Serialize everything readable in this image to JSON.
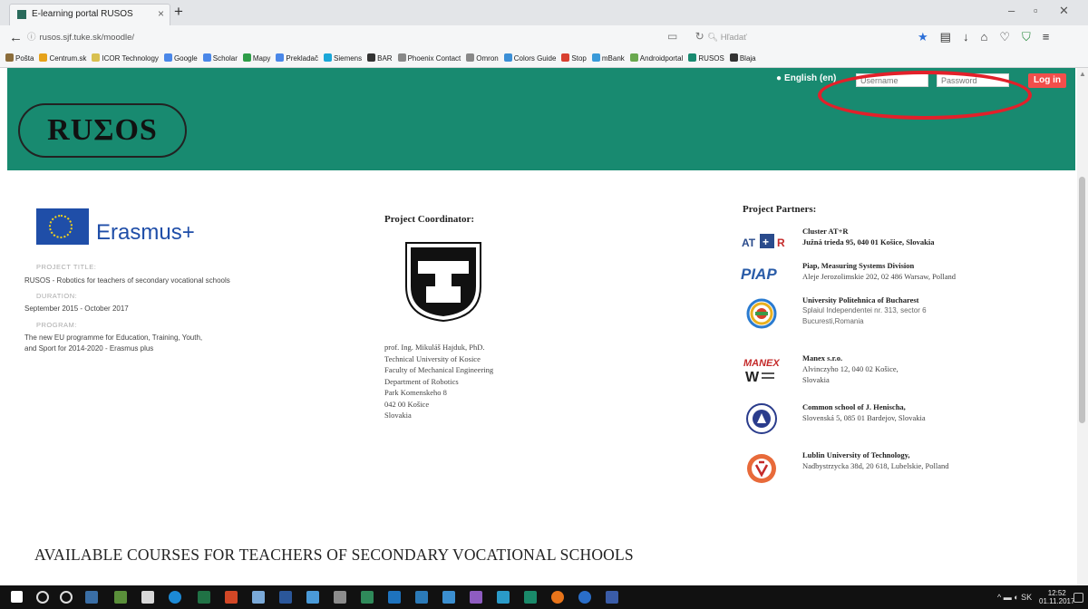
{
  "browser": {
    "tab_title": "E-learning portal RUSOS",
    "url": "rusos.sjf.tuke.sk/moodle/",
    "search_placeholder": "Hľadať",
    "bookmarks": [
      {
        "label": "Pošta",
        "color": "#8b6d3b"
      },
      {
        "label": "Centrum.sk",
        "color": "#e6a21a"
      },
      {
        "label": "ICOR Technology",
        "color": "#d8c050"
      },
      {
        "label": "Google",
        "color": "#4a87e8"
      },
      {
        "label": "Scholar",
        "color": "#4a87e8"
      },
      {
        "label": "Mapy",
        "color": "#2e9d48"
      },
      {
        "label": "Prekladač",
        "color": "#4a87e8"
      },
      {
        "label": "Siemens",
        "color": "#1aa7d8"
      },
      {
        "label": "BAR",
        "color": "#333333"
      },
      {
        "label": "Phoenix Contact",
        "color": "#888888"
      },
      {
        "label": "Omron",
        "color": "#888888"
      },
      {
        "label": "Colors Guide",
        "color": "#3c8fd6"
      },
      {
        "label": "Stop",
        "color": "#d84030"
      },
      {
        "label": "mBank",
        "color": "#3a9ad9"
      },
      {
        "label": "Androidportal",
        "color": "#6aa84f"
      },
      {
        "label": "RUSOS",
        "color": "#188a70"
      },
      {
        "label": "Blaja",
        "color": "#333333"
      }
    ]
  },
  "header": {
    "language": "English (en)",
    "username_placeholder": "Username",
    "password_placeholder": "Password",
    "login_label": "Log in",
    "logo_text": "RUΣOS"
  },
  "project": {
    "erasmus_label": "Erasmus+",
    "title_label": "PROJECT TITLE:",
    "title_value": "RUSOS - Robotics for teachers of secondary vocational schools",
    "duration_label": "DURATION:",
    "duration_value": "September 2015 - October 2017",
    "program_label": "PROGRAM:",
    "program_value_1": "The new EU programme for Education, Training, Youth,",
    "program_value_2": "and Sport for 2014-2020 - Erasmus plus"
  },
  "coordinator": {
    "heading": "Project Coordinator:",
    "lines": [
      "prof. Ing. Mikuláš Hajduk, PhD.",
      "Technical University of Kosice",
      "Faculty of Mechanical Engineering",
      "Department of Robotics",
      "Park Komenskeho 8",
      "042 00 Košice",
      "Slovakia"
    ]
  },
  "partners": {
    "heading": "Project Partners:",
    "items": [
      {
        "name": "Cluster AT+R",
        "line2": "Južná trieda 95, 040 01 Košice, Slovakia"
      },
      {
        "name": "Piap, Measuring Systems Division",
        "line2": "Aleje Jerozolimskie 202, 02 486 Warsaw, Polland"
      },
      {
        "name": "University Politehnica of Bucharest",
        "line2": "Splaiul Independentei nr. 313, sector 6",
        "line3": "Bucuresti,Romania"
      },
      {
        "name": "Manex s.r.o.",
        "line2": "Alvinczyho 12, 040 02 Košice,",
        "line3": "Slovakia"
      },
      {
        "name": "Common school of J. Henischa,",
        "line2": "Slovenská 5, 085 01 Bardejov, Slovakia"
      },
      {
        "name": "Lublin University of Technology,",
        "line2": "Nadbystrzycka 38d, 20 618, Lubelskie, Polland"
      }
    ]
  },
  "courses_heading": "AVAILABLE COURSES FOR TEACHERS OF SECONDARY VOCATIONAL SCHOOLS",
  "taskbar": {
    "time": "12:52",
    "date": "01.11.2017",
    "tray_text": "SK"
  },
  "colors": {
    "header_green": "#188a70",
    "login_red": "#f34e4b",
    "annotation_red": "#e2202a",
    "erasmus_blue": "#1f4ea8"
  }
}
